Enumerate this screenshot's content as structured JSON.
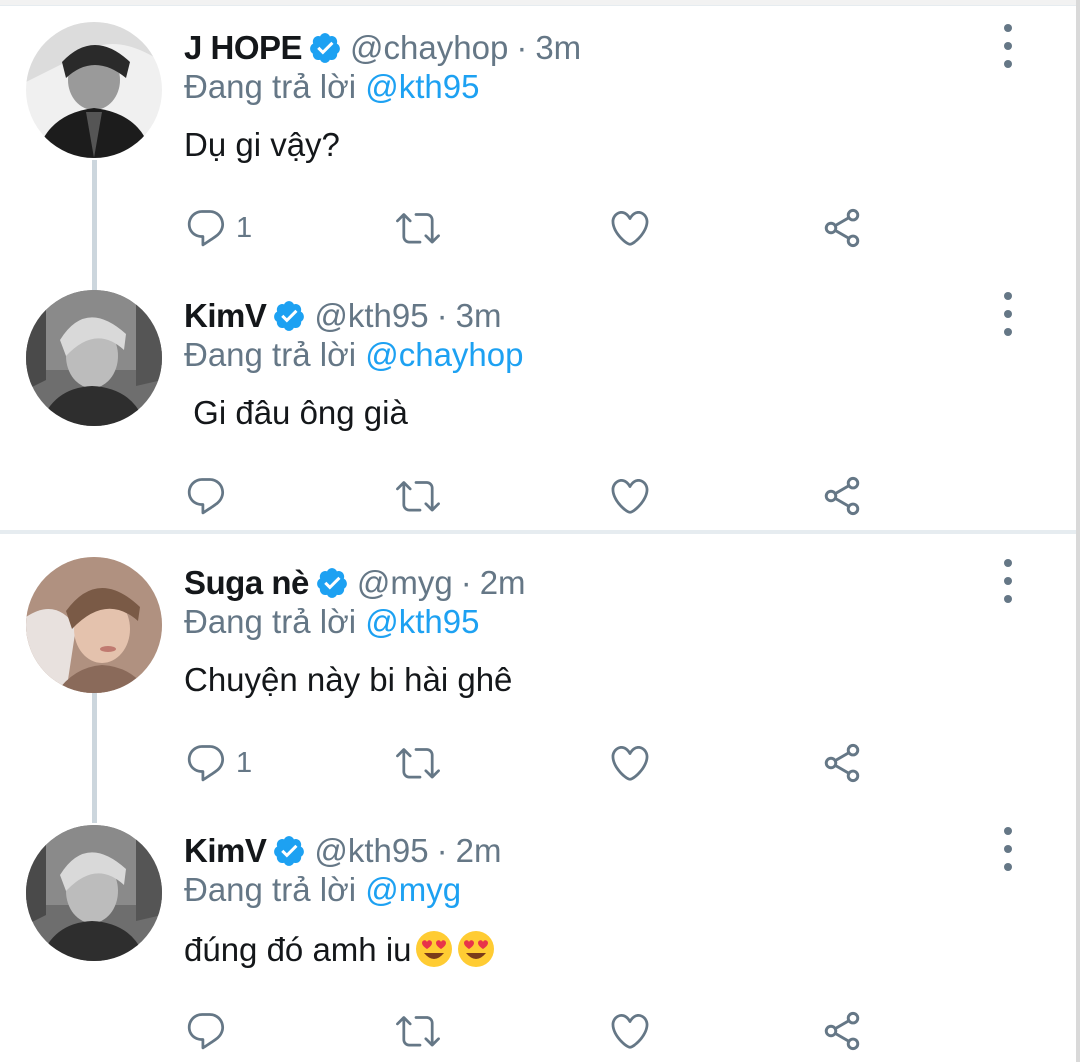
{
  "replying_prefix": "Đang trả lời",
  "tweets": [
    {
      "name": "J HOPE",
      "handle": "@chayhop",
      "separator": "·",
      "time": "3m",
      "replying_to": "@kth95",
      "text": "Dụ gi vậy?",
      "reply_count": "1",
      "avatar_icon": "avatar-jhope"
    },
    {
      "name": "KimV",
      "handle": "@kth95",
      "separator": "·",
      "time": "3m",
      "replying_to": "@chayhop",
      "text": " Gi đâu ông già",
      "reply_count": "",
      "avatar_icon": "avatar-kimv"
    },
    {
      "name": "Suga nè",
      "handle": "@myg",
      "separator": "·",
      "time": "2m",
      "replying_to": "@kth95",
      "text": "Chuyện này bi hài ghê",
      "reply_count": "1",
      "avatar_icon": "avatar-suga"
    },
    {
      "name": "KimV",
      "handle": "@kth95",
      "separator": "·",
      "time": "2m",
      "replying_to": "@myg",
      "text": "đúng đó amh iu",
      "emojis": [
        "heart-eyes-emoji",
        "heart-eyes-emoji"
      ],
      "reply_count": "",
      "avatar_icon": "avatar-kimv"
    }
  ],
  "colors": {
    "verified": "#1da1f2",
    "mention": "#1da1f2",
    "muted": "#657786",
    "text": "#14171a",
    "icon": "#657786"
  }
}
